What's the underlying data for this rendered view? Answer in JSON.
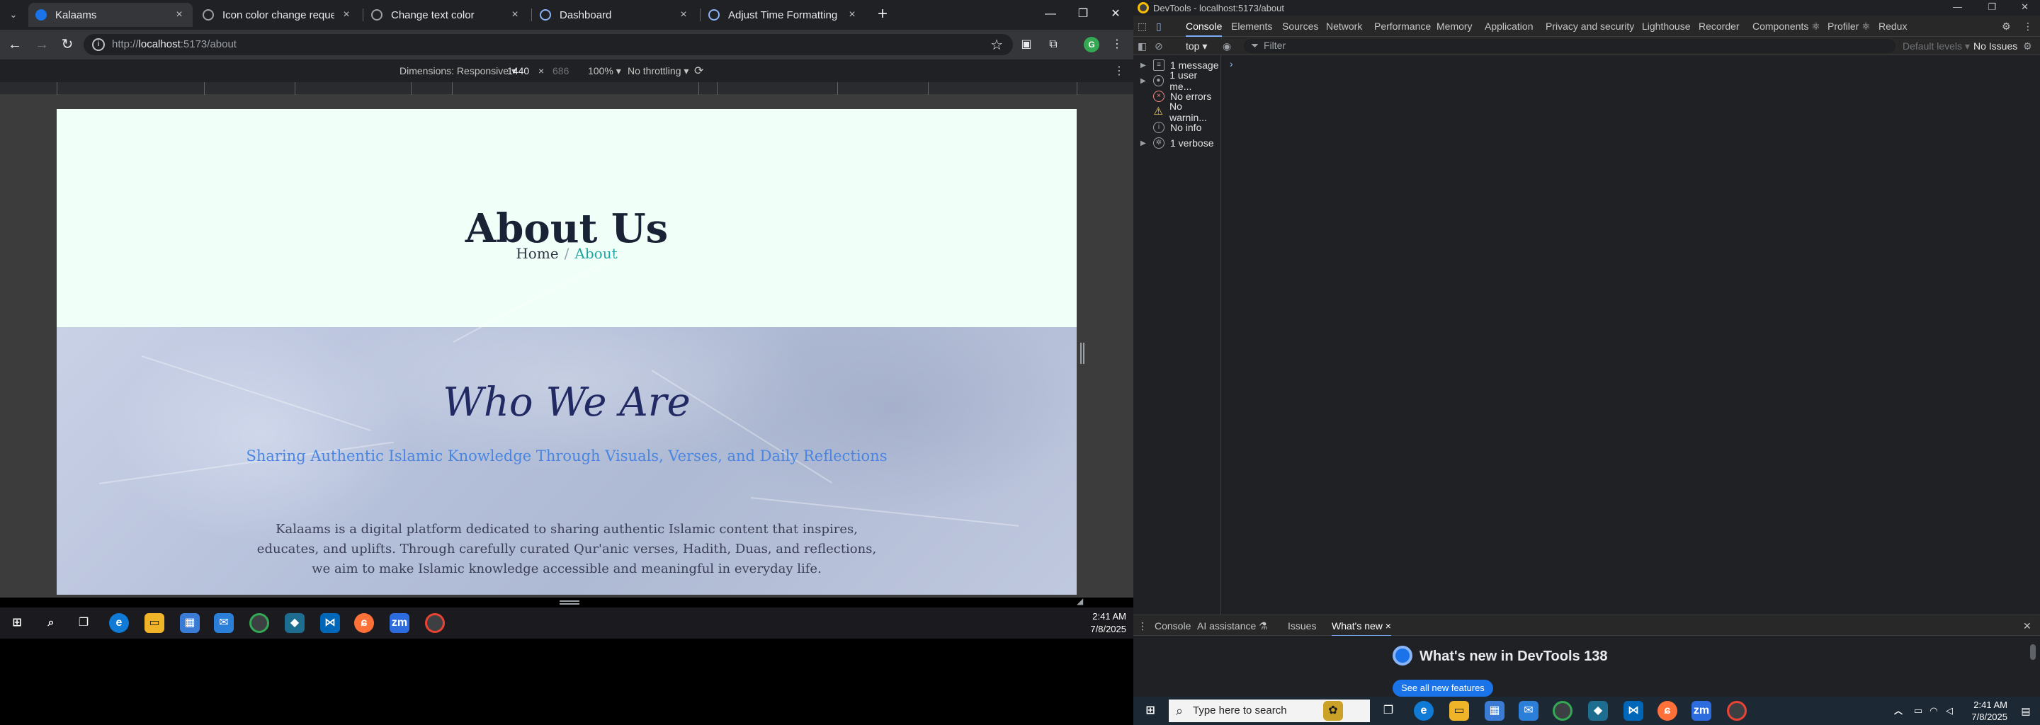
{
  "browser": {
    "tabs": [
      {
        "title": "Kalaams",
        "active": true
      },
      {
        "title": "Icon color change request",
        "active": false
      },
      {
        "title": "Change text color",
        "active": false
      },
      {
        "title": "Dashboard",
        "active": false
      },
      {
        "title": "Adjust Time Formatting for AM",
        "active": false
      }
    ],
    "url_prefix": "http://",
    "url_host": "localhost",
    "url_rest": ":5173/about",
    "profile_initial": "G"
  },
  "device_toolbar": {
    "dimensions_label": "Dimensions: Responsive ▾",
    "width": "1440",
    "times": "×",
    "height": "686",
    "zoom": "100% ▾",
    "throttling": "No throttling ▾"
  },
  "page": {
    "hero_title": "About Us",
    "breadcrumb_home": "Home",
    "breadcrumb_sep": "/",
    "breadcrumb_current": "About",
    "who_title": "Who We Are",
    "who_subtitle": "Sharing Authentic Islamic Knowledge Through Visuals, Verses, and Daily Reflections",
    "who_body": "Kalaams is a digital platform dedicated to sharing authentic Islamic content that inspires, educates, and uplifts. Through carefully curated Qur'anic verses, Hadith, Duas, and reflections, we aim to make Islamic knowledge accessible and meaningful in everyday life."
  },
  "taskbar_left": {
    "time": "2:41 AM",
    "date": "7/8/2025"
  },
  "devtools": {
    "window_title": "DevTools - localhost:5173/about",
    "tabs": [
      "Console",
      "Elements",
      "Sources",
      "Network",
      "Performance",
      "Memory",
      "Application",
      "Privacy and security",
      "Lighthouse",
      "Recorder",
      "Components ⚛",
      "Profiler ⚛",
      "Redux"
    ],
    "context": "top ▾",
    "filter_placeholder": "Filter",
    "levels": "Default levels ▾",
    "issues": "No Issues",
    "sidebar": [
      {
        "label": "1 message",
        "icon": "list-icon"
      },
      {
        "label": "1 user me...",
        "icon": "user-icon"
      },
      {
        "label": "No errors",
        "icon": "error-icon"
      },
      {
        "label": "No warnin...",
        "icon": "warning-icon"
      },
      {
        "label": "No info",
        "icon": "info-icon"
      },
      {
        "label": "1 verbose",
        "icon": "bug-icon"
      }
    ],
    "prompt": "›",
    "drawer_tabs": [
      "Console",
      "AI assistance ⚗",
      "Issues",
      "What's new ×"
    ],
    "whats_new_title": "What's new in DevTools 138",
    "whats_new_button": "See all new features"
  },
  "taskbar_right": {
    "search_placeholder": "Type here to search",
    "time": "2:41 AM",
    "date": "7/8/2025"
  }
}
